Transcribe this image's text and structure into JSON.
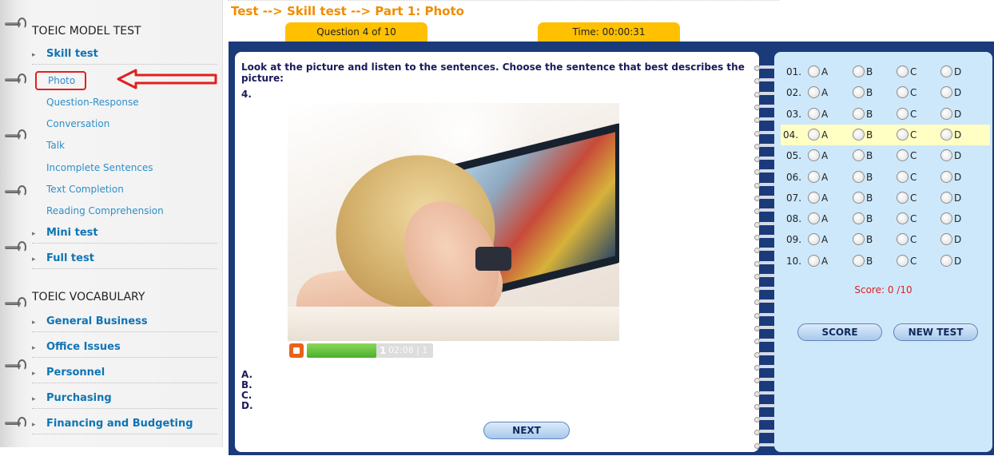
{
  "sidebar": {
    "model_test_title": "TOEIC MODEL TEST",
    "skill_test": "Skill test",
    "sub_items": [
      "Photo",
      "Question-Response",
      "Conversation",
      "Talk",
      "Incomplete Sentences",
      "Text Completion",
      "Reading Comprehension"
    ],
    "mini_test": "Mini test",
    "full_test": "Full test",
    "vocabulary_title": "TOEIC VOCABULARY",
    "vocab_items": [
      "General Business",
      "Office Issues",
      "Personnel",
      "Purchasing",
      "Financing and Budgeting"
    ],
    "highlight_color": "#e02020"
  },
  "header": {
    "breadcrumb": "Test --> Skill test --> Part 1: Photo",
    "question_tab": "Question 4 of 10",
    "time_tab": "Time: 00:00:31"
  },
  "question": {
    "instruction": "Look at the picture and listen to the sentences. Choose the sentence that best describes the picture:",
    "number": "4.",
    "audio": {
      "track_label": "1",
      "time": "02:08 | 1",
      "progress": 0.55
    },
    "choices": [
      "A.",
      "B.",
      "C.",
      "D."
    ],
    "next_label": "NEXT"
  },
  "answers": {
    "rows": [
      "01.",
      "02.",
      "03.",
      "04.",
      "05.",
      "06.",
      "07.",
      "08.",
      "09.",
      "10."
    ],
    "options": [
      "A",
      "B",
      "C",
      "D"
    ],
    "current_row": "04.",
    "score_text": "Score: 0 /10",
    "score_button": "SCORE",
    "new_test_button": "NEW TEST"
  },
  "colors": {
    "accent_orange": "#f08c00",
    "tab_yellow": "#ffc000",
    "panel_navy": "#1b3a7a",
    "answer_bg": "#cde8fb",
    "link_blue": "#0f74b4"
  }
}
